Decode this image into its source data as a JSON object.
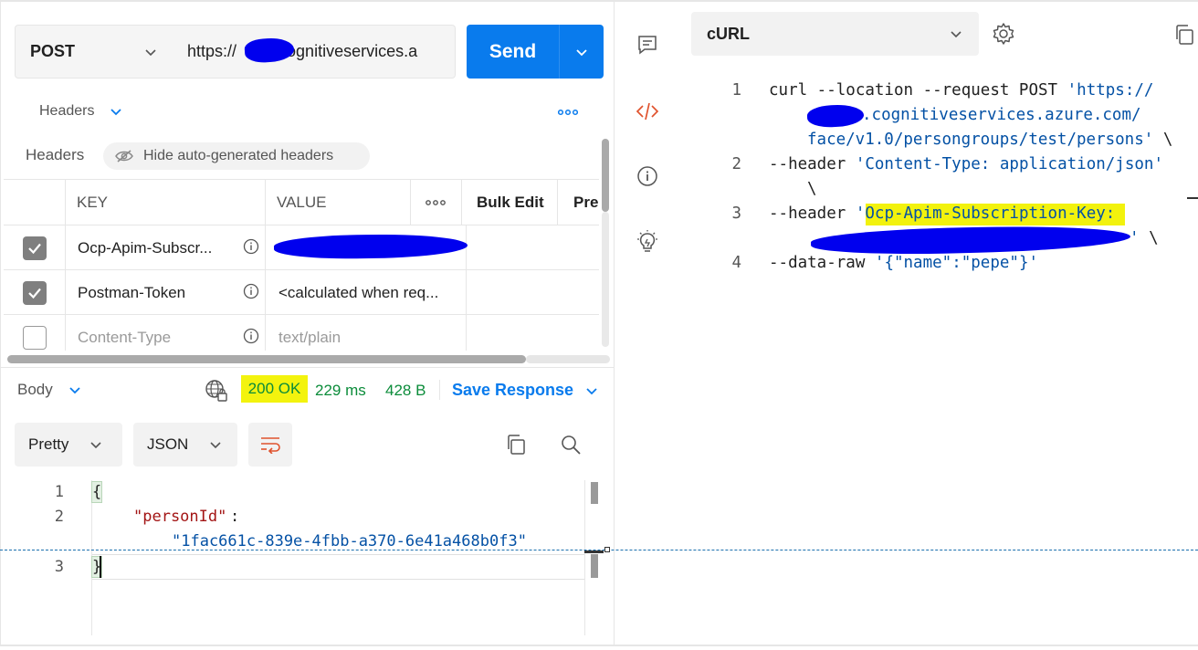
{
  "request": {
    "method": "POST",
    "url_prefix": "https://",
    "url_suffix": "cognitiveservices.a",
    "send_label": "Send"
  },
  "headers_section": {
    "tab_label": "Headers",
    "section_label": "Headers",
    "hide_auto_label": "Hide auto-generated headers",
    "columns": {
      "key": "KEY",
      "value": "VALUE",
      "more": "ooo",
      "bulk_edit": "Bulk Edit",
      "presets": "Pre"
    },
    "rows": [
      {
        "key": "Ocp-Apim-Subscr...",
        "value": "",
        "checked": true
      },
      {
        "key": "Postman-Token",
        "value": "<calculated when req...",
        "checked": true
      },
      {
        "key": "Content-Type",
        "value": "text/plain",
        "checked": false
      }
    ]
  },
  "response": {
    "body_label": "Body",
    "status": "200 OK",
    "time": "229 ms",
    "size": "428 B",
    "save_label": "Save Response",
    "format_label": "Pretty",
    "type_label": "JSON",
    "lines": {
      "n1": "1",
      "n2": "2",
      "n3": "3",
      "open_brace": "{",
      "key": "\"personId\"",
      "colon": ":",
      "value": "\"1fac661c-839e-4fbb-a370-6e41a468b0f3\"",
      "close_brace": "}"
    }
  },
  "snippet": {
    "language": "cURL",
    "line_numbers": [
      "1",
      "2",
      "3",
      "4"
    ],
    "l1a": "curl --location --request POST ",
    "l1b": "'https://",
    "l1c": ".cognitiveservices.azure.com/",
    "l1d": "face/v1.0/persongroups/test/persons'",
    "l1e": " \\",
    "l2a": "--header ",
    "l2b": "'Content-Type: application/json'",
    "l2c": "\\",
    "l3a": "--header ",
    "l3b": "'",
    "l3c": "Ocp-Apim-Subscription-Key:",
    "l3d": "'",
    "l3e": " \\",
    "l4a": "--data-raw ",
    "l4b": "'{\"name\":\"pepe\"}'"
  },
  "colors": {
    "accent": "#097bed",
    "status_ok": "#0b8c3a",
    "highlight": "#f2f20d",
    "redaction": "#0000ee",
    "string": "#0451a5",
    "json_key": "#a31515"
  }
}
